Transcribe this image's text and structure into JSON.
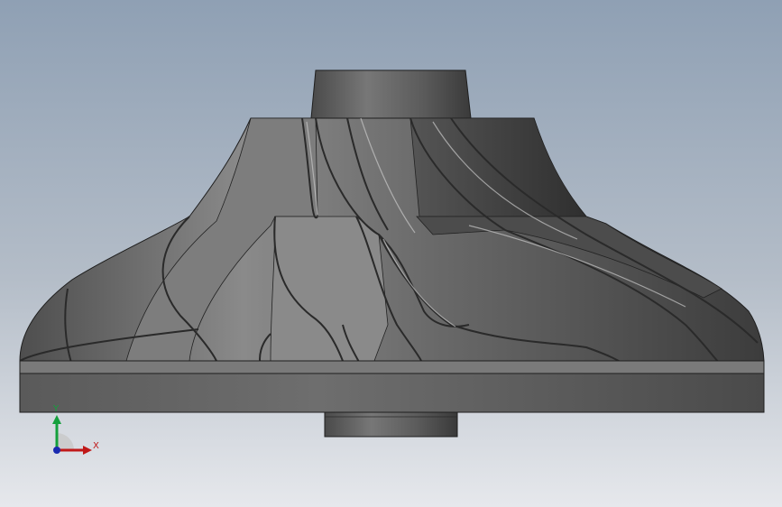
{
  "triad": {
    "x_label": "X",
    "y_label": "Y",
    "x_color": "#c01818",
    "y_color": "#14a03c",
    "z_color": "#1a2ab0"
  },
  "colors": {
    "background_top": "#8fa0b4",
    "background_bottom": "#e6e8ec",
    "part_dark": "#3f3f3f",
    "part_mid": "#6a6a6a",
    "part_light": "#9c9c9c"
  }
}
